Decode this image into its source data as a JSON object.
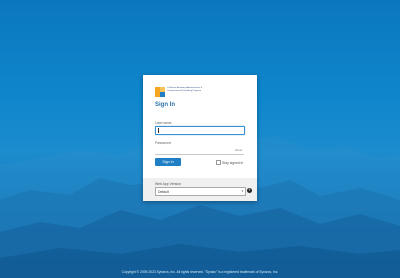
{
  "logo": {
    "icon": "sf-logo-icon",
    "brand_colors": [
      "#f5a623",
      "#1f7fc4"
    ],
    "text": "California Academy Administration & Computerized Scheduling Program"
  },
  "form": {
    "title": "Sign In",
    "username_label": "Username",
    "username_value": "",
    "password_label": "Password",
    "password_value": "",
    "show_label": "show",
    "signin_button": "Sign In",
    "remember_label": "Stay signed in",
    "remember_checked": false
  },
  "app_version": {
    "label": "Web App Version",
    "selected": "Default",
    "help_icon": "help-icon"
  },
  "footer": {
    "copyright": "Copyright © 2009-2023 Synarcs, Inc. All rights reserved. \"Synarc\" is a registered trademark of Synarcs, Inc."
  },
  "colors": {
    "background": "#0f86cc",
    "accent": "#1f7fc4"
  }
}
